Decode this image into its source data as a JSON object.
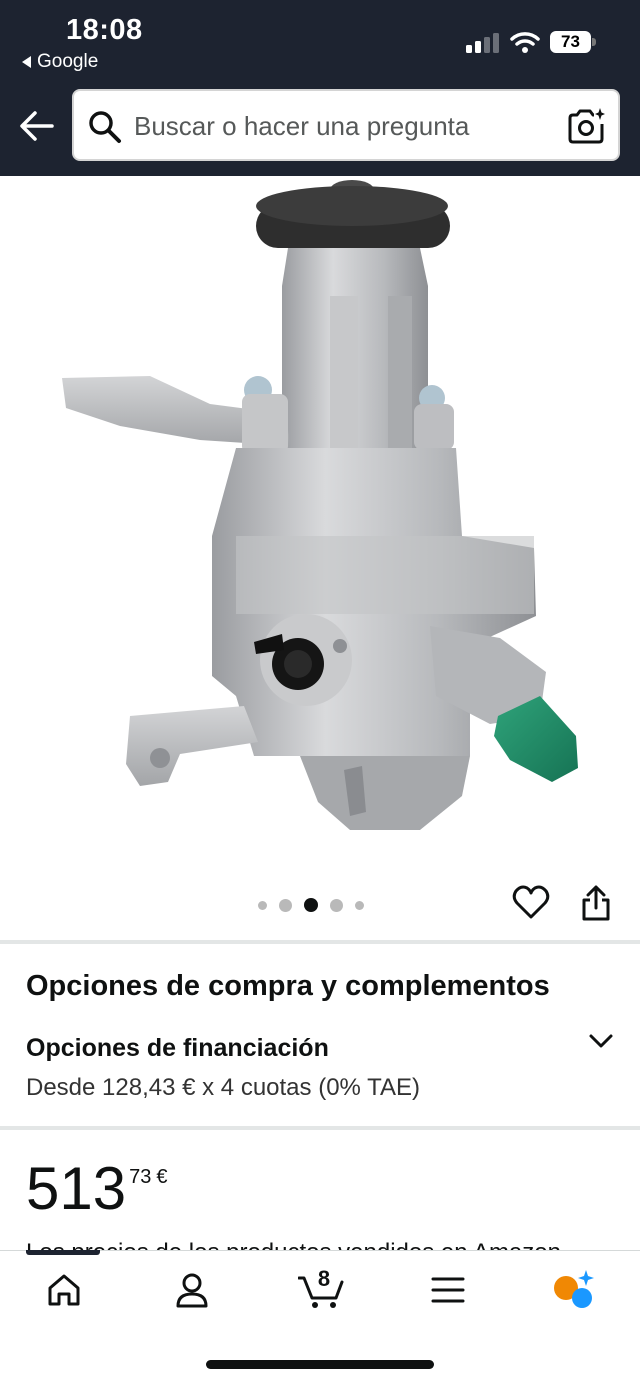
{
  "status_bar": {
    "time": "18:08",
    "back_app": "Google",
    "battery": "73"
  },
  "search": {
    "placeholder": "Buscar o hacer una pregunta"
  },
  "gallery": {
    "image_count": 5,
    "active_index": 2
  },
  "purchase_options": {
    "title": "Opciones de compra y complementos",
    "financing_title": "Opciones de financiación",
    "financing_detail": "Desde 128,43 € x 4 cuotas (0% TAE)"
  },
  "price": {
    "whole": "513",
    "fraction": "73",
    "currency": "€"
  },
  "partial_text": "Los precios de los productos vendidos en Amazon",
  "bottom_nav": {
    "cart_count": "8"
  },
  "colors": {
    "header_bg": "#1d2330",
    "accent_orange": "#f08804",
    "accent_blue": "#1a98ff"
  }
}
